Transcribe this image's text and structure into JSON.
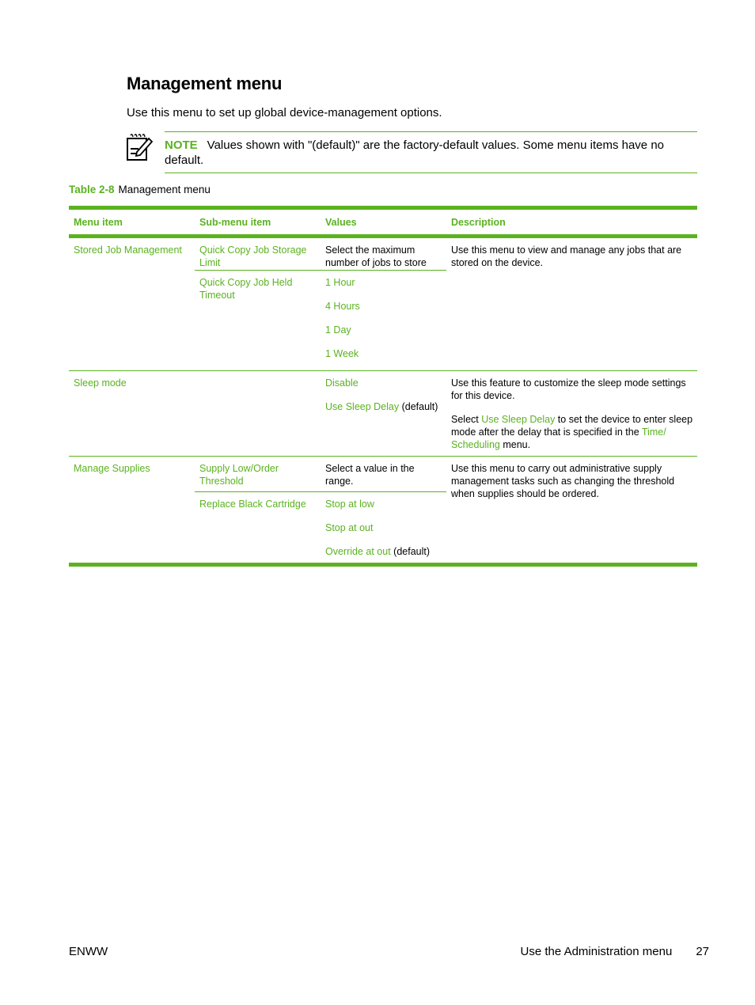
{
  "page": {
    "title": "Management menu",
    "intro": "Use this menu to set up global device-management options.",
    "note": {
      "label": "NOTE",
      "text": "Values shown with \"(default)\" are the factory-default values. Some menu items have no default.",
      "icon": "note-pencil-icon"
    },
    "caption": {
      "label": "Table 2-8",
      "text": "Management menu"
    }
  },
  "colors": {
    "accent": "#5bb220",
    "text": "#000000"
  },
  "table": {
    "headers": [
      "Menu item",
      "Sub-menu item",
      "Values",
      "Description"
    ],
    "groups": [
      {
        "menu_item": "Stored Job Management",
        "subs": [
          {
            "name": "Quick Copy Job Storage Limit",
            "values": [
              {
                "text": "Select the maximum number of jobs to store",
                "link": false
              }
            ]
          },
          {
            "name": "Quick Copy Job Held Timeout",
            "values": [
              {
                "text": "1 Hour",
                "link": true
              },
              {
                "text": "4 Hours",
                "link": true
              },
              {
                "text": "1 Day",
                "link": true
              },
              {
                "text": "1 Week",
                "link": true
              }
            ]
          }
        ],
        "description": [
          "Use this menu to view and manage any jobs that are stored on the device."
        ]
      },
      {
        "menu_item": "Sleep mode",
        "subs": [
          {
            "name": "",
            "values": [
              {
                "text": "Disable",
                "link": true
              },
              {
                "text": "Use Sleep Delay",
                "link": true,
                "suffix": " (default)"
              }
            ]
          }
        ],
        "description_parts": {
          "p1": "Use this feature to customize the sleep mode settings for this device.",
          "p2_a": "Select ",
          "p2_link1": "Use Sleep Delay",
          "p2_b": " to set the device to enter sleep mode after the delay that is specified in the ",
          "p2_link2": "Time/ Scheduling",
          "p2_c": " menu."
        }
      },
      {
        "menu_item": "Manage Supplies",
        "subs": [
          {
            "name": "Supply Low/Order Threshold",
            "values": [
              {
                "text": "Select a value in the range.",
                "link": false
              }
            ]
          },
          {
            "name": "Replace Black Cartridge",
            "values": [
              {
                "text": "Stop at low",
                "link": true
              },
              {
                "text": "Stop at out",
                "link": true
              },
              {
                "text": "Override at out",
                "link": true,
                "suffix": " (default)"
              }
            ]
          }
        ],
        "description": [
          "Use this menu to carry out administrative supply management tasks such as changing the threshold when supplies should be ordered."
        ]
      }
    ]
  },
  "footer": {
    "left": "ENWW",
    "section": "Use the Administration menu",
    "page_number": "27"
  }
}
